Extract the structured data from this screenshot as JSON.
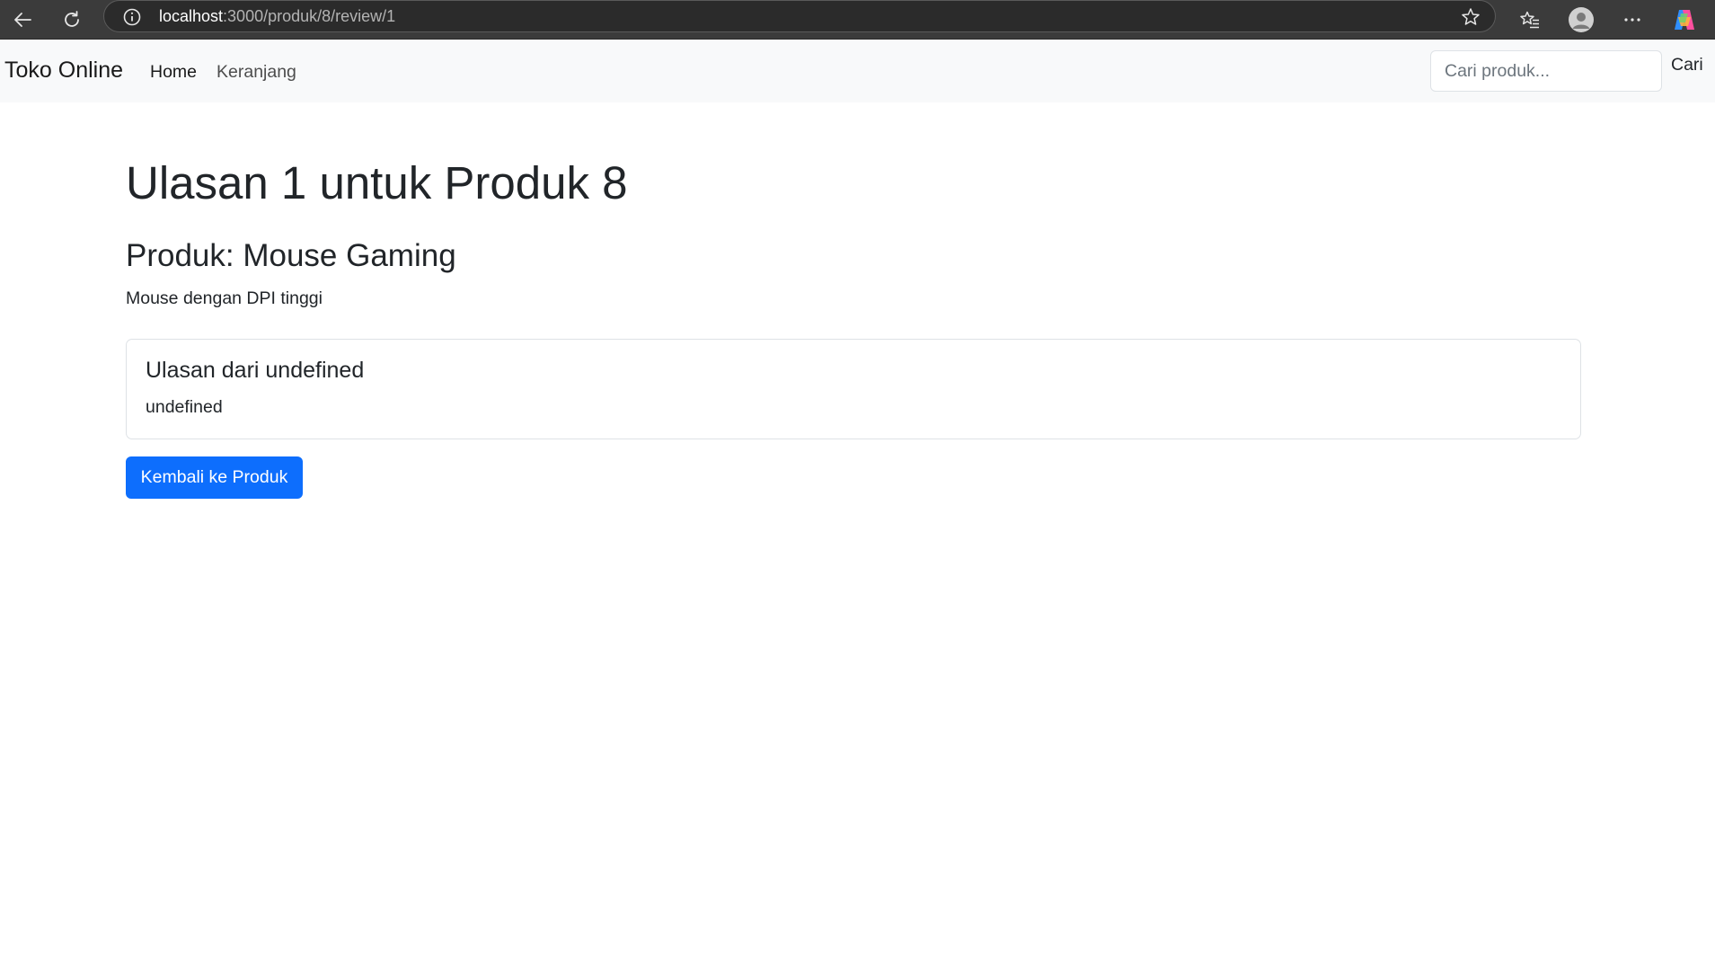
{
  "browser": {
    "url_host": "localhost",
    "url_path": ":3000/produk/8/review/1",
    "icons": [
      "back-arrow-icon",
      "reload-icon",
      "site-info-icon",
      "bookmark-star-icon",
      "favorites-icon",
      "profile-avatar-icon",
      "more-menu-icon",
      "copilot-icon"
    ]
  },
  "navbar": {
    "brand": "Toko Online",
    "links": [
      {
        "label": "Home"
      },
      {
        "label": "Keranjang"
      }
    ],
    "search": {
      "placeholder": "Cari produk...",
      "value": "",
      "button_label": "Cari"
    }
  },
  "main": {
    "heading": "Ulasan 1 untuk Produk 8",
    "product_title": "Produk: Mouse Gaming",
    "product_description": "Mouse dengan DPI tinggi",
    "review": {
      "title": "Ulasan dari undefined",
      "text": "undefined"
    },
    "back_button_label": "Kembali ke Produk"
  },
  "colors": {
    "primary": "#0d6efd",
    "navbar_bg": "#f8f9fa",
    "chrome_bg": "#3b3b3b"
  }
}
